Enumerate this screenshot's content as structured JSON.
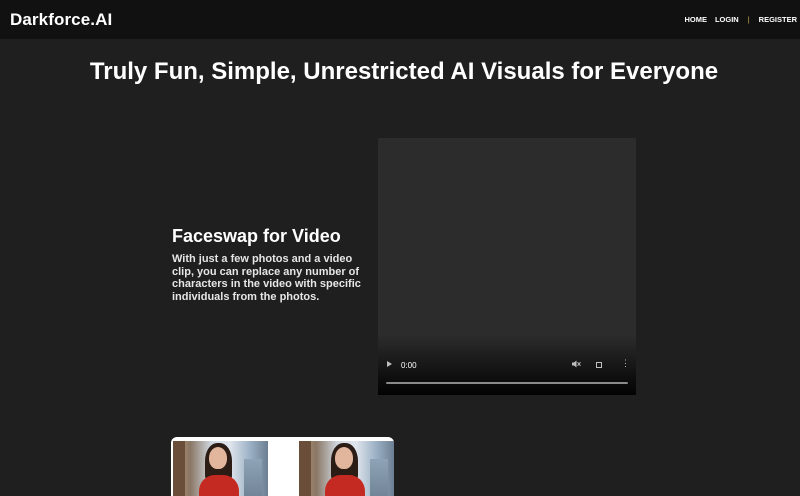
{
  "navbar": {
    "brand": "Darkforce.AI",
    "links": {
      "home": "HOME",
      "login": "LOGIN",
      "separator": "|",
      "register": "REGISTER"
    }
  },
  "hero": {
    "title": "Truly Fun, Simple, Unrestricted AI Visuals for Everyone"
  },
  "feature": {
    "heading": "Faceswap for Video",
    "description": "With just a few photos and a video clip, you can replace any number of characters in the video with specific individuals from the photos."
  },
  "video": {
    "time": "0:00",
    "progress": 0,
    "icons": [
      "play-icon",
      "mute-icon",
      "fullscreen-icon",
      "more-options-icon"
    ]
  },
  "colors": {
    "background": "#1f1f1f",
    "navbar": "#111111",
    "video_background": "#2c2c2c",
    "separator": "#d9b25a"
  }
}
